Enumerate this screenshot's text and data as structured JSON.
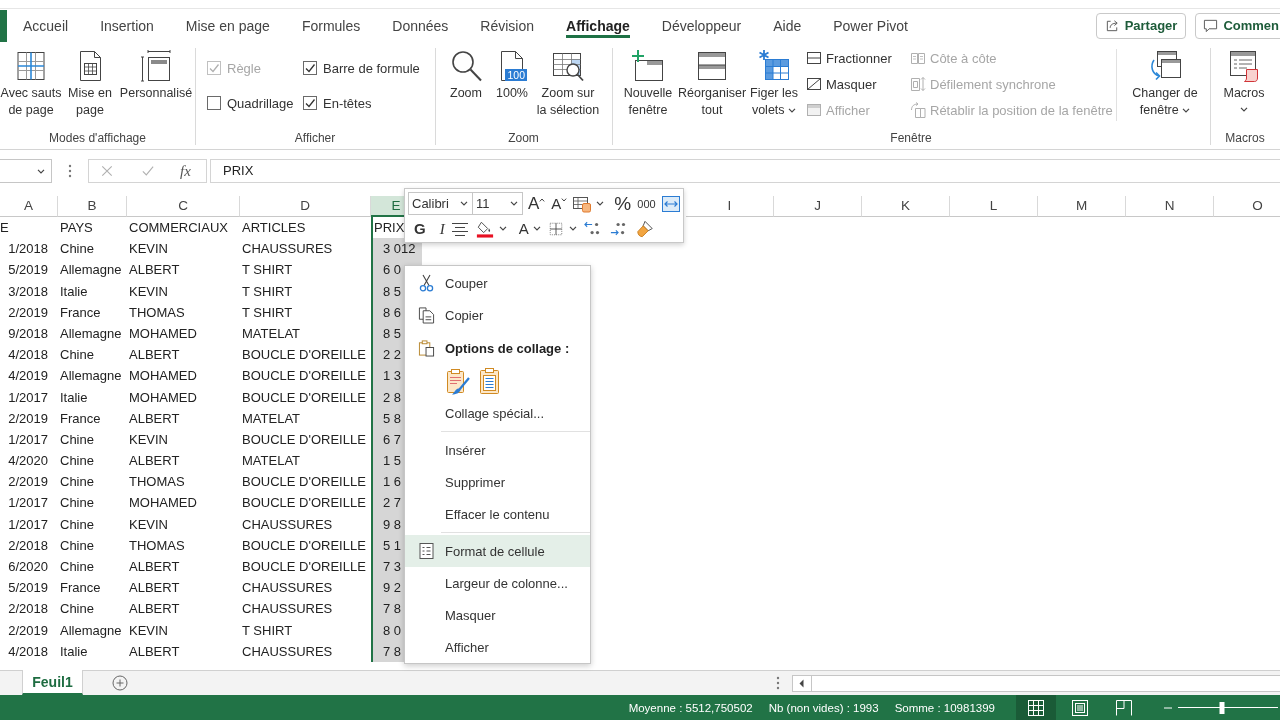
{
  "ribbon_tabs": [
    {
      "label": "Accueil",
      "selected": false
    },
    {
      "label": "Insertion",
      "selected": false
    },
    {
      "label": "Mise en page",
      "selected": false
    },
    {
      "label": "Formules",
      "selected": false
    },
    {
      "label": "Données",
      "selected": false
    },
    {
      "label": "Révision",
      "selected": false
    },
    {
      "label": "Affichage",
      "selected": true
    },
    {
      "label": "Développeur",
      "selected": false
    },
    {
      "label": "Aide",
      "selected": false
    },
    {
      "label": "Power Pivot",
      "selected": false
    }
  ],
  "share_button": "Partager",
  "comments_button": "Commen",
  "ribbon": {
    "view_modes": {
      "label": "Modes d'affichage",
      "buttons": [
        "Avec sauts de page",
        "Mise en page",
        "Personnalisé"
      ]
    },
    "show": {
      "label": "Afficher",
      "options": [
        {
          "label": "Règle",
          "checked": true,
          "disabled": true
        },
        {
          "label": "Barre de formule",
          "checked": true,
          "disabled": false
        },
        {
          "label": "Quadrillage",
          "checked": false,
          "disabled": false
        },
        {
          "label": "En-têtes",
          "checked": true,
          "disabled": false
        }
      ]
    },
    "zoom": {
      "label": "Zoom",
      "buttons": [
        {
          "label": "Zoom"
        },
        {
          "label": "100%",
          "badge": "100"
        },
        {
          "label": "Zoom sur la sélection"
        }
      ]
    },
    "window": {
      "label": "Fenêtre",
      "large_buttons": [
        {
          "label": "Nouvelle fenêtre",
          "dropdown": false
        },
        {
          "label": "Réorganiser tout",
          "dropdown": false
        },
        {
          "label": "Figer les volets",
          "dropdown": true
        }
      ],
      "small_buttons": [
        {
          "label": "Fractionner",
          "disabled": false
        },
        {
          "label": "Masquer",
          "disabled": false
        },
        {
          "label": "Afficher",
          "disabled": true
        },
        {
          "label": "Côte à côte",
          "disabled": true
        },
        {
          "label": "Défilement synchrone",
          "disabled": true
        },
        {
          "label": "Rétablir la position de la fenêtre",
          "disabled": true
        }
      ],
      "switch_button": {
        "label": "Changer de fenêtre",
        "dropdown": true
      }
    },
    "macros": {
      "label": "Macros",
      "button": {
        "label": "Macros",
        "dropdown": true
      }
    }
  },
  "formula_bar": {
    "function_button": "fx",
    "value": "PRIX"
  },
  "mini_toolbar": {
    "font": "Calibri",
    "size": "11",
    "grow_font": "A",
    "shrink_font": "A",
    "percent": "%",
    "thousands": "000",
    "bold": "G",
    "italic": "I",
    "font_color": "A"
  },
  "columns": [
    {
      "label": "A",
      "selected": false
    },
    {
      "label": "B",
      "selected": false
    },
    {
      "label": "C",
      "selected": false
    },
    {
      "label": "D",
      "selected": false
    },
    {
      "label": "E",
      "selected": true
    },
    {
      "label": "I",
      "selected": false
    },
    {
      "label": "J",
      "selected": false
    },
    {
      "label": "K",
      "selected": false
    },
    {
      "label": "L",
      "selected": false
    },
    {
      "label": "M",
      "selected": false
    },
    {
      "label": "N",
      "selected": false
    },
    {
      "label": "O",
      "selected": false
    }
  ],
  "header_row": [
    "E",
    "PAYS",
    "COMMERCIAUX",
    "ARTICLES",
    "PRIX"
  ],
  "rows": [
    [
      "1/2018",
      "Chine",
      "KEVIN",
      "CHAUSSURES",
      "3 012"
    ],
    [
      "5/2019",
      "Allemagne",
      "ALBERT",
      "T SHIRT",
      "6 0"
    ],
    [
      "3/2018",
      "Italie",
      "KEVIN",
      "T SHIRT",
      "8 5"
    ],
    [
      "2/2019",
      "France",
      "THOMAS",
      "T SHIRT",
      "8 6"
    ],
    [
      "9/2018",
      "Allemagne",
      "MOHAMED",
      "MATELAT",
      "8 5"
    ],
    [
      "4/2018",
      "Chine",
      "ALBERT",
      "BOUCLE D'OREILLE",
      "2 2"
    ],
    [
      "4/2019",
      "Allemagne",
      "MOHAMED",
      "BOUCLE D'OREILLE",
      "1 3"
    ],
    [
      "1/2017",
      "Italie",
      "MOHAMED",
      "BOUCLE D'OREILLE",
      "2 8"
    ],
    [
      "2/2019",
      "France",
      "ALBERT",
      "MATELAT",
      "5 8"
    ],
    [
      "1/2017",
      "Chine",
      "KEVIN",
      "BOUCLE D'OREILLE",
      "6 7"
    ],
    [
      "4/2020",
      "Chine",
      "ALBERT",
      "MATELAT",
      "1 5"
    ],
    [
      "2/2019",
      "Chine",
      "THOMAS",
      "BOUCLE D'OREILLE",
      "1 6"
    ],
    [
      "1/2017",
      "Chine",
      "MOHAMED",
      "BOUCLE D'OREILLE",
      "2 7"
    ],
    [
      "1/2017",
      "Chine",
      "KEVIN",
      "CHAUSSURES",
      "9 8"
    ],
    [
      "2/2018",
      "Chine",
      "THOMAS",
      "BOUCLE D'OREILLE",
      "5 1"
    ],
    [
      "6/2020",
      "Chine",
      "ALBERT",
      "BOUCLE D'OREILLE",
      "7 3"
    ],
    [
      "5/2019",
      "France",
      "ALBERT",
      "CHAUSSURES",
      "9 2"
    ],
    [
      "2/2018",
      "Chine",
      "ALBERT",
      "CHAUSSURES",
      "7 8"
    ],
    [
      "2/2019",
      "Allemagne",
      "KEVIN",
      "T SHIRT",
      "8 0"
    ],
    [
      "4/2018",
      "Italie",
      "ALBERT",
      "CHAUSSURES",
      "7 8"
    ]
  ],
  "context_menu": {
    "items": [
      {
        "kind": "command",
        "label": "Couper",
        "highlighted": false
      },
      {
        "kind": "command",
        "label": "Copier",
        "highlighted": false
      },
      {
        "kind": "heading",
        "label": "Options de collage :"
      },
      {
        "kind": "paste_options"
      },
      {
        "kind": "command",
        "label": "Collage spécial...",
        "highlighted": false
      },
      {
        "kind": "separator"
      },
      {
        "kind": "command",
        "label": "Insérer",
        "highlighted": false
      },
      {
        "kind": "command",
        "label": "Supprimer",
        "highlighted": false
      },
      {
        "kind": "command",
        "label": "Effacer le contenu",
        "highlighted": false
      },
      {
        "kind": "separator"
      },
      {
        "kind": "command",
        "label": "Format de cellule",
        "highlighted": true
      },
      {
        "kind": "command",
        "label": "Largeur de colonne...",
        "highlighted": false
      },
      {
        "kind": "command",
        "label": "Masquer",
        "highlighted": false
      },
      {
        "kind": "command",
        "label": "Afficher",
        "highlighted": false
      }
    ]
  },
  "sheet_tabs": [
    {
      "label": "Feuil1",
      "selected": true
    }
  ],
  "status_bar": {
    "average": "Moyenne : 5512,750502",
    "count": "Nb (non vides) : 1993",
    "sum": "Somme : 10981399",
    "views": [
      {
        "selected": true
      },
      {
        "selected": false
      },
      {
        "selected": false
      }
    ],
    "zoom": {
      "level": 0.44
    }
  }
}
